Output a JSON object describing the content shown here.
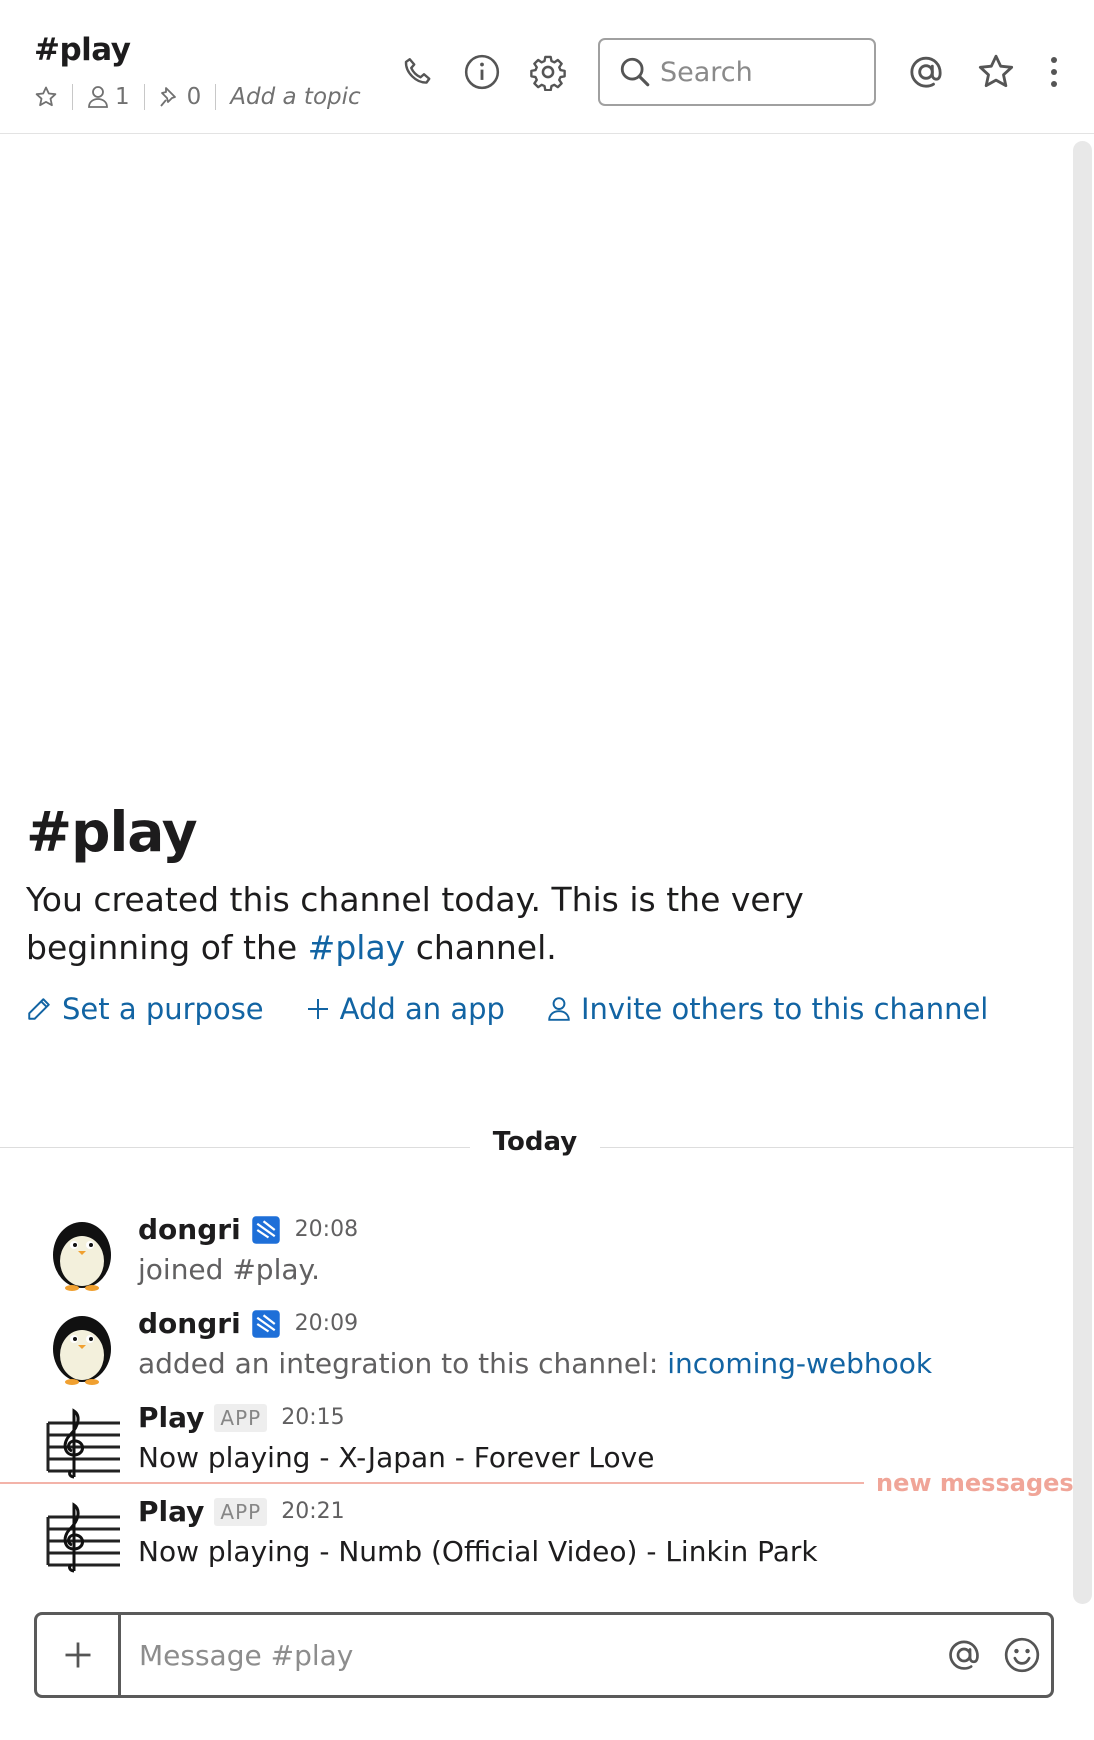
{
  "header": {
    "channel_name": "#play",
    "member_count": "1",
    "pinned_count": "0",
    "topic_placeholder": "Add a topic",
    "search_placeholder": "Search"
  },
  "intro": {
    "title": "#play",
    "text_before": "You created this channel today. This is the very beginning of the ",
    "channel_link": "#play",
    "text_after": " channel.",
    "actions": {
      "purpose": "Set a purpose",
      "app": "Add an app",
      "invite": "Invite others to this channel"
    }
  },
  "divider": {
    "label": "Today"
  },
  "messages": [
    {
      "author": "dongri",
      "time": "20:08",
      "text": "joined #play.",
      "muted": true,
      "avatar": "penguin-avatar"
    },
    {
      "author": "dongri",
      "time": "20:09",
      "text": "added an integration to this channel: ",
      "link": "incoming-webhook",
      "muted": true,
      "avatar": "penguin-avatar"
    },
    {
      "author": "Play",
      "badge": "APP",
      "time": "20:15",
      "text": "Now playing - X-Japan - Forever Love",
      "avatar": "music-staff-avatar"
    },
    {
      "author": "Play",
      "badge": "APP",
      "time": "20:21",
      "text": "Now playing - Numb (Official Video) - Linkin Park",
      "avatar": "music-staff-avatar"
    }
  ],
  "new_messages_label": "new messages",
  "composer": {
    "placeholder": "Message #play"
  },
  "colors": {
    "link": "#1264a3",
    "new_messages": "#f0a598",
    "app_icon": "#1e6fd8"
  }
}
